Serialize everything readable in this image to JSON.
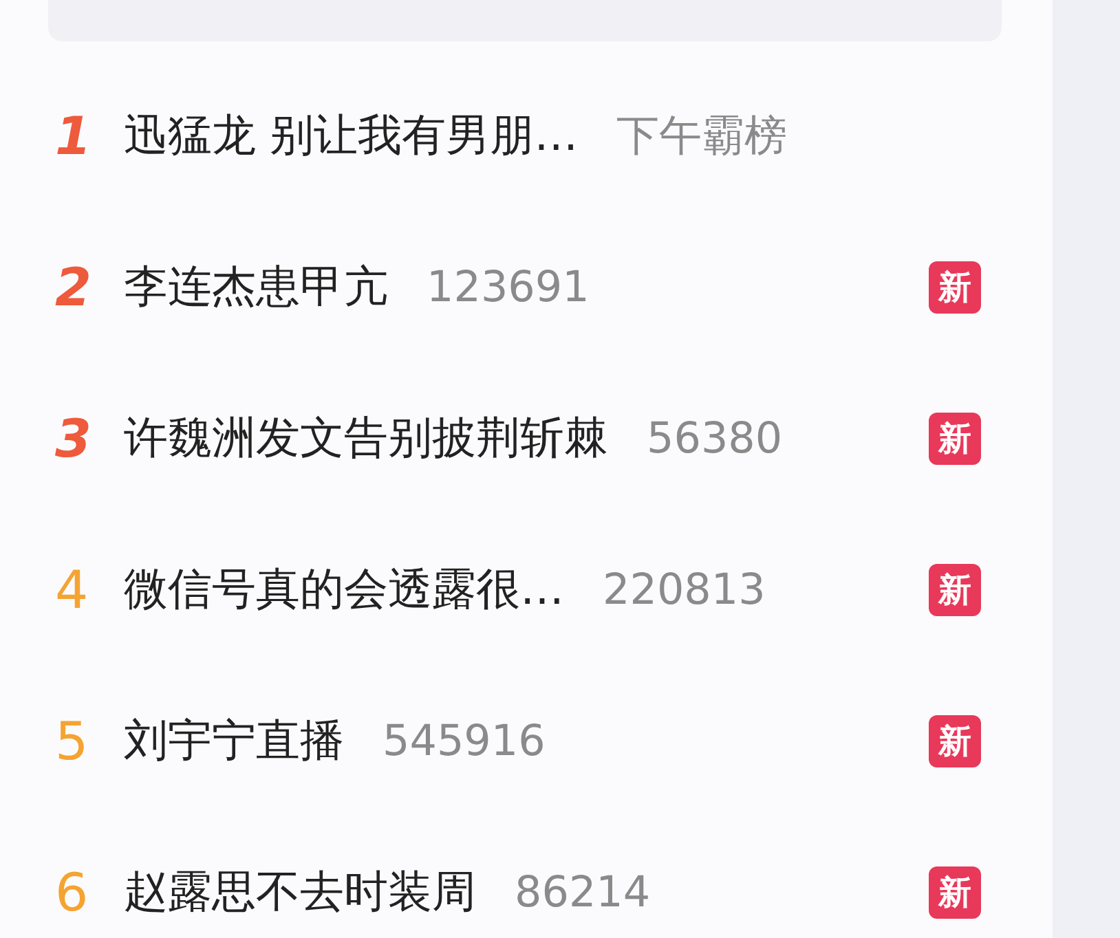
{
  "hot_list": [
    {
      "rank": "1",
      "kind": "top",
      "color": "#ee5a3c",
      "title": "迅猛龙 别让我有男朋…",
      "count": "下午霸榜"
    },
    {
      "rank": "2",
      "kind": "top",
      "color": "#ee5a3c",
      "title": "李连杰患甲亢",
      "count": "123691",
      "badge": "新"
    },
    {
      "rank": "3",
      "kind": "top",
      "color": "#ee5a3c",
      "title": "许魏洲发文告别披荆斩棘",
      "count": "56380",
      "badge": "新"
    },
    {
      "rank": "4",
      "kind": "normal",
      "color": "#f5a331",
      "title": "微信号真的会透露很…",
      "count": "220813",
      "badge": "新"
    },
    {
      "rank": "5",
      "kind": "normal",
      "color": "#f5a331",
      "title": "刘宇宁直播",
      "count": "545916",
      "badge": "新"
    },
    {
      "rank": "6",
      "kind": "normal",
      "color": "#f5a331",
      "title": "赵露思不去时装周",
      "count": "86214",
      "badge": "新"
    }
  ]
}
